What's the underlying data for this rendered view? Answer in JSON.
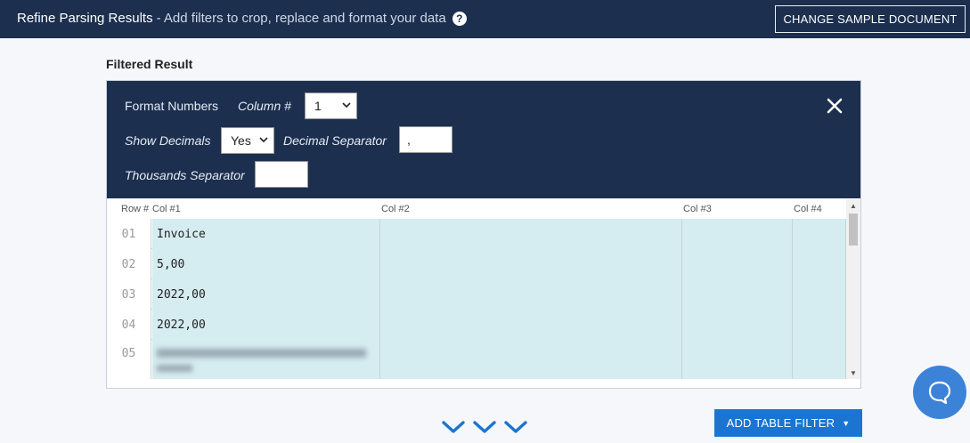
{
  "header": {
    "title": "Refine Parsing Results",
    "subtitle": "- Add filters to crop, replace and format your data",
    "help_icon": "question-circle-icon",
    "change_button": "CHANGE SAMPLE DOCUMENT"
  },
  "section": {
    "label": "Filtered Result"
  },
  "filter": {
    "name": "Format Numbers",
    "column_label": "Column #",
    "column_value": "1",
    "show_decimals_label": "Show Decimals",
    "show_decimals_value": "Yes",
    "decimal_separator_label": "Decimal Separator",
    "decimal_separator_value": ",",
    "thousands_separator_label": "Thousands Separator",
    "thousands_separator_value": "",
    "close_icon": "close-icon"
  },
  "grid": {
    "columns": [
      "Row #",
      "Col #1",
      "Col #2",
      "Col #3",
      "Col #4"
    ],
    "rows": [
      {
        "num": "01",
        "col1": "Invoice",
        "col2": "",
        "col3": "",
        "col4": ""
      },
      {
        "num": "02",
        "col1": "5,00",
        "col2": "",
        "col3": "",
        "col4": ""
      },
      {
        "num": "03",
        "col1": "2022,00",
        "col2": "",
        "col3": "",
        "col4": ""
      },
      {
        "num": "04",
        "col1": "2022,00",
        "col2": "",
        "col3": "",
        "col4": ""
      },
      {
        "num": "05",
        "col1": "",
        "col2": "",
        "col3": "",
        "col4": ""
      }
    ]
  },
  "footer": {
    "add_filter_button": "ADD TABLE FILTER",
    "chevrons_icon": "triple-chevron-down-icon",
    "chat_icon": "chat-bubble-icon"
  },
  "colors": {
    "header_bg": "#1c2f4f",
    "accent": "#1a75d2",
    "cell_bg": "#d5ecf0"
  }
}
